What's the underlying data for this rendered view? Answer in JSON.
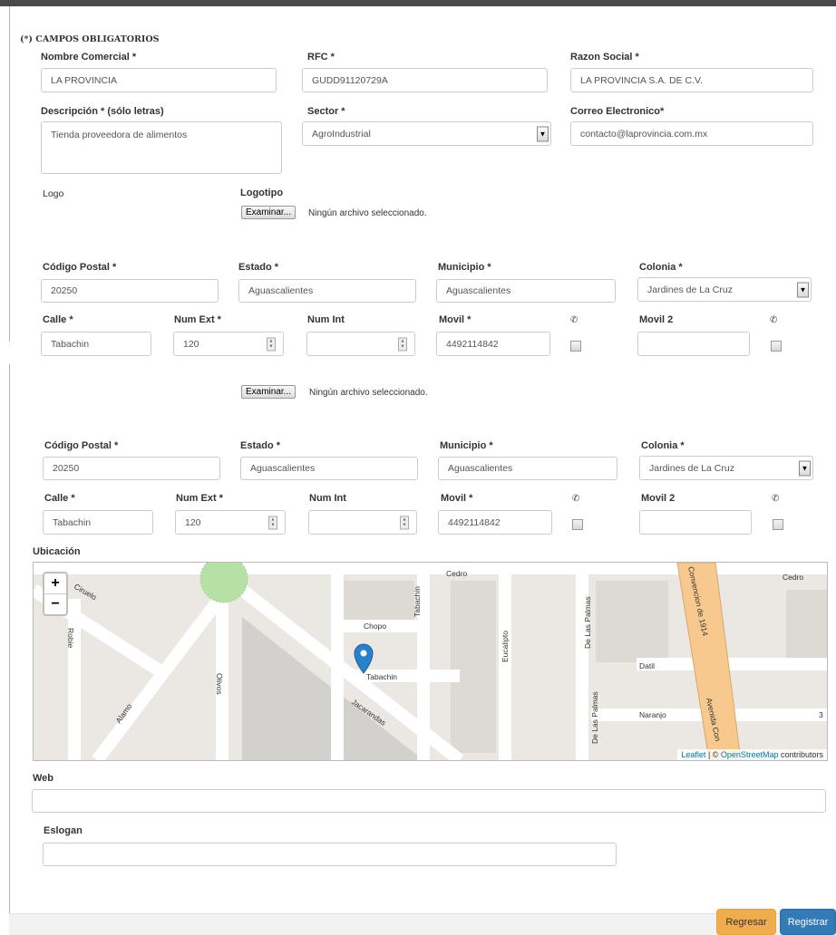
{
  "required_note": "(*) CAMPOS OBLIGATORIOS",
  "business": {
    "nombre_label": "Nombre Comercial *",
    "nombre_value": "LA PROVINCIA",
    "rfc_label": "RFC *",
    "rfc_value": "GUDD91120729A",
    "razon_label": "Razon Social *",
    "razon_value": "LA PROVINCIA S.A. DE C.V.",
    "desc_label": "Descripción * (sólo letras)",
    "desc_value": "Tienda proveedora de alimentos",
    "sector_label": "Sector *",
    "sector_value": "AgroIndustrial",
    "correo_label": "Correo Electronico*",
    "correo_value": "contacto@laprovincia.com.mx",
    "logo_left_label": "Logo",
    "logotipo_label": "Logotipo",
    "file_button": "Examinar...",
    "file_none": "Ningún archivo seleccionado."
  },
  "address": {
    "cp_label": "Código Postal *",
    "cp_value": "20250",
    "estado_label": "Estado *",
    "estado_value": "Aguascalientes",
    "municipio_label": "Municipio *",
    "municipio_value": "Aguascalientes",
    "colonia_label": "Colonia *",
    "colonia_value": "Jardines de La Cruz",
    "calle_label": "Calle *",
    "calle_value": "Tabachin",
    "numext_label": "Num Ext *",
    "numext_value": "120",
    "numint_label": "Num Int",
    "numint_value": "",
    "movil_label": "Movil *",
    "movil_value": "4492114842",
    "movil2_label": "Movil 2",
    "movil2_value": "",
    "whatsapp_glyph": "✆"
  },
  "map": {
    "ubicacion_label": "Ubicación",
    "zoom_in": "+",
    "zoom_out": "−",
    "streets": [
      "Cedro",
      "Cedro",
      "Ciruelo",
      "Robie",
      "Chopo",
      "Tabachin",
      "Tabachin",
      "Eucalipto",
      "De Las Palmas",
      "De Las Palmas",
      "Datil",
      "Naranjo",
      "Alamo",
      "Olivos",
      "Jacarandas",
      "Convencion de 1914",
      "Avenida Con",
      "3"
    ],
    "attribution_leaflet": "Leaflet",
    "attribution_sep": " | © ",
    "attribution_osm": "OpenStreetMap",
    "attribution_rest": " contributors",
    "colors": {
      "park": "#b7e0a6",
      "avenue": "#f7c98f",
      "marker": "#2a81cb"
    }
  },
  "extra": {
    "web_label": "Web",
    "web_value": "",
    "eslogan_label": "Eslogan",
    "eslogan_value": ""
  },
  "footer": {
    "regresar_label": "Regresar",
    "registrar_label": "Registrar",
    "regresar_color": "#f0ad4e",
    "registrar_color": "#337ab7"
  }
}
